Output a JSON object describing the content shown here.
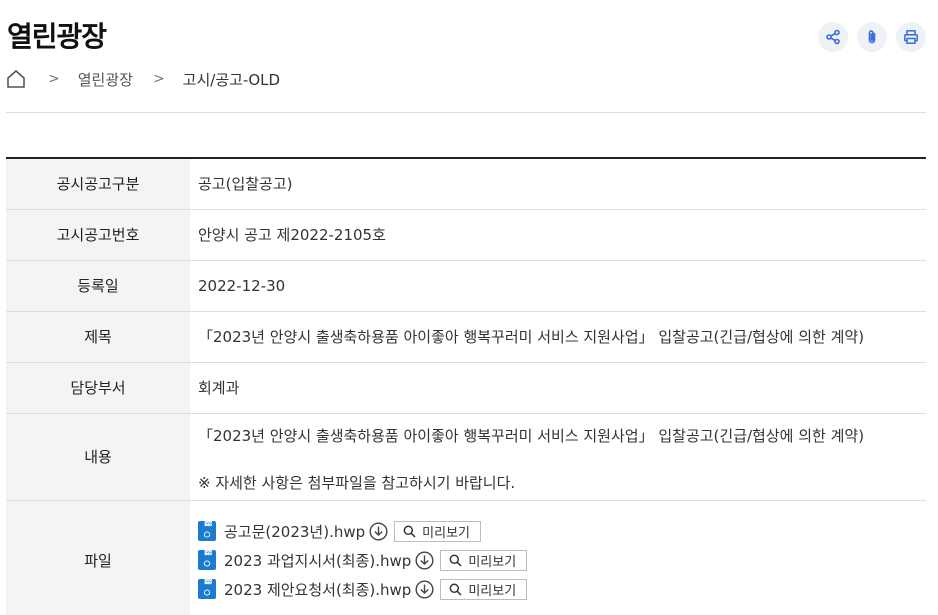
{
  "page": {
    "title": "열린광장"
  },
  "actions": {
    "share_icon": "share-icon",
    "attach_icon": "paperclip-icon",
    "print_icon": "print-icon"
  },
  "breadcrumb": {
    "home_icon": "home-icon",
    "items": [
      "열린광장",
      "고시/공고-OLD"
    ]
  },
  "table": {
    "rows": [
      {
        "label": "공시공고구분",
        "value": "공고(입찰공고)"
      },
      {
        "label": "고시공고번호",
        "value": "안양시 공고 제2022-2105호"
      },
      {
        "label": "등록일",
        "value": "2022-12-30"
      },
      {
        "label": "제목",
        "value": "「2023년 안양시 출생축하용품 아이좋아 행복꾸러미 서비스 지원사업」 입찰공고(긴급/협상에 의한 계약)"
      },
      {
        "label": "담당부서",
        "value": "회계과"
      }
    ],
    "content": {
      "label": "내용",
      "line1": "「2023년 안양시 출생축하용품 아이좋아 행복꾸러미 서비스 지원사업」 입찰공고(긴급/협상에 의한 계약)",
      "line2": "※ 자세한 사항은 첨부파일을 참고하시기 바랍니다."
    },
    "files": {
      "label": "파일",
      "preview_label": "미리보기",
      "items": [
        {
          "name": "공고문(2023년).hwp",
          "type_glyph": "ᢆ"
        },
        {
          "name": "2023 과업지시서(최종).hwp",
          "type_glyph": "ᢆ"
        },
        {
          "name": "2023 제안요청서(최종).hwp",
          "type_glyph": "ᢆ"
        }
      ]
    }
  }
}
